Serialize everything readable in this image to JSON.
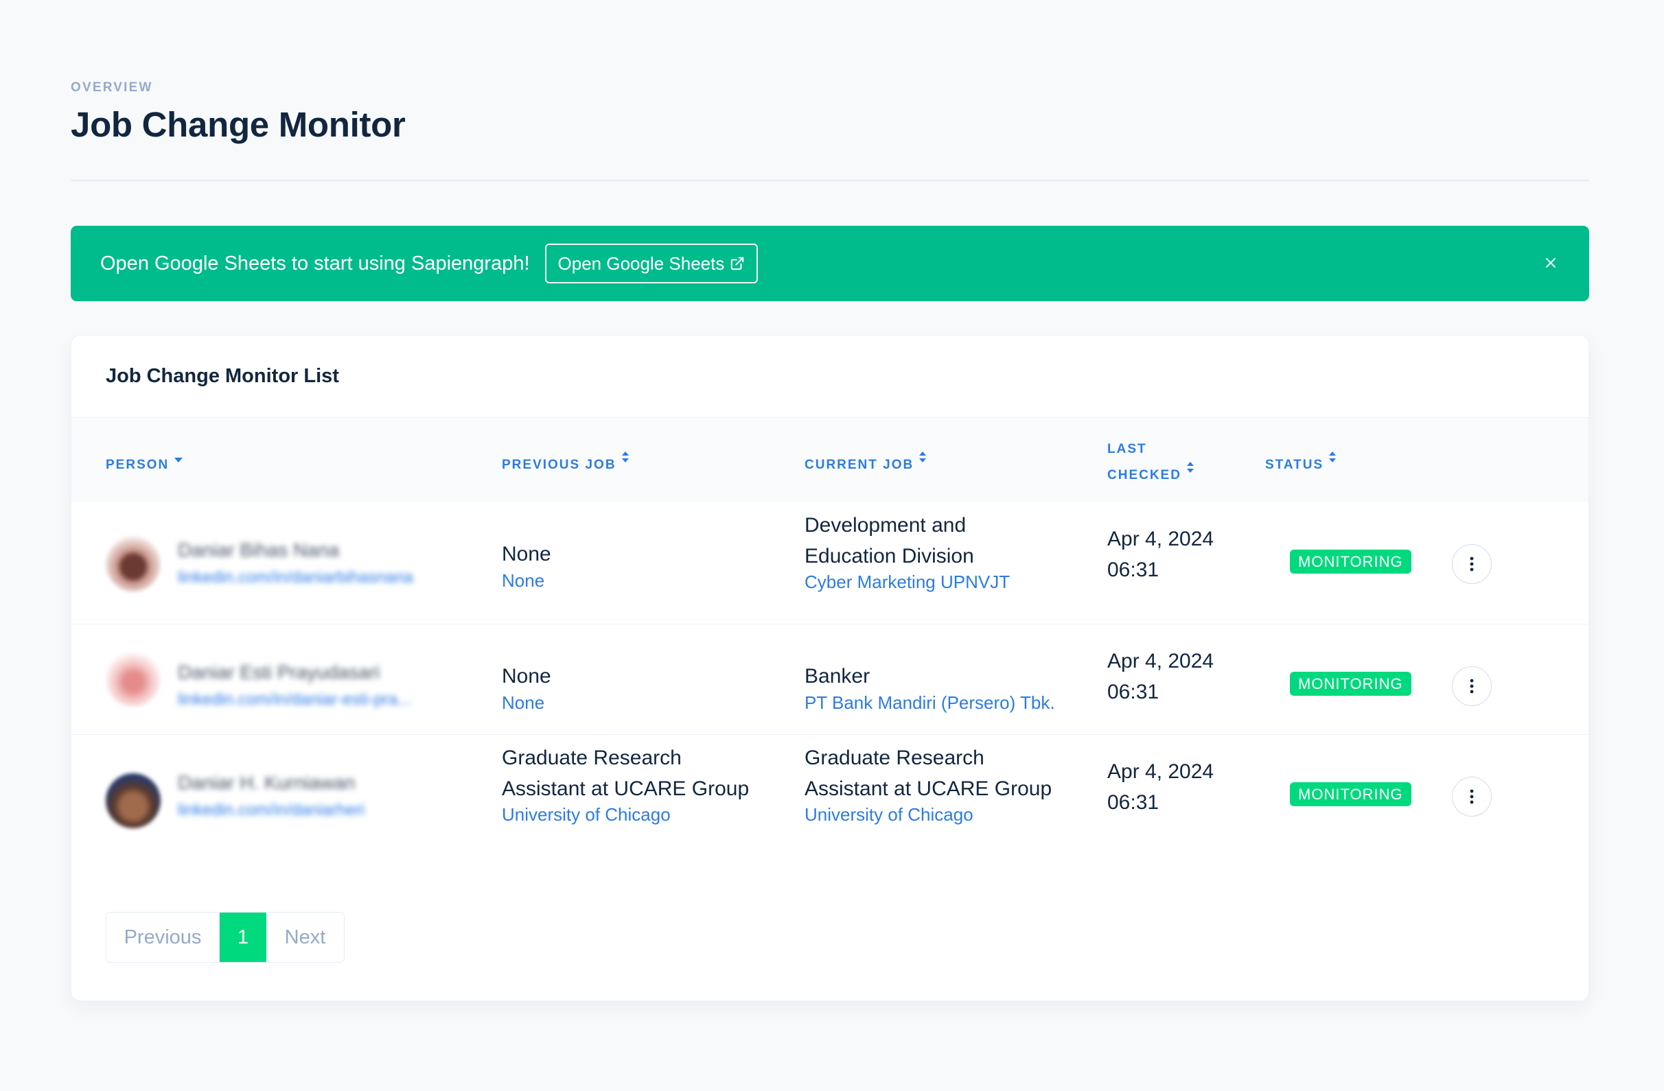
{
  "header": {
    "pretitle": "OVERVIEW",
    "title": "Job Change Monitor"
  },
  "banner": {
    "text": "Open Google Sheets to start using Sapiengraph!",
    "button_label": "Open Google Sheets",
    "button_icon": "external-link-icon",
    "close_icon": "close-icon",
    "color": "#00bb8c"
  },
  "card": {
    "title": "Job Change Monitor List"
  },
  "table": {
    "columns": [
      {
        "label": "PERSON",
        "sort_icon": "caret-down-icon"
      },
      {
        "label": "PREVIOUS JOB",
        "sort_icon": "sort-icon"
      },
      {
        "label": "CURRENT JOB",
        "sort_icon": "sort-icon"
      },
      {
        "label_line1": "LAST",
        "label_line2": "CHECKED",
        "sort_icon": "sort-icon"
      },
      {
        "label": "STATUS",
        "sort_icon": "sort-icon"
      }
    ],
    "rows": [
      {
        "person_name": "Daniar Bihas Nana",
        "person_link": "linkedin.com/in/daniarbihasnana",
        "prev_title": "None",
        "prev_org": "None",
        "cur_title_line1": "Development and",
        "cur_title_line2": "Education Division",
        "cur_org": "Cyber Marketing UPNVJT",
        "date_line1": "Apr 4, 2024",
        "date_line2": "06:31",
        "status": "MONITORING"
      },
      {
        "person_name": "Daniar Esti Prayudasari",
        "person_link": "linkedin.com/in/daniar-esti-pra...",
        "prev_title": "None",
        "prev_org": "None",
        "cur_title_line1": "Banker",
        "cur_org": "PT Bank Mandiri (Persero) Tbk.",
        "date_line1": "Apr 4, 2024",
        "date_line2": "06:31",
        "status": "MONITORING"
      },
      {
        "person_name": "Daniar H. Kurniawan",
        "person_link": "linkedin.com/in/daniarheri",
        "prev_title_line1": "Graduate Research",
        "prev_title_line2": "Assistant at UCARE Group",
        "prev_org": "University of Chicago",
        "cur_title_line1": "Graduate Research",
        "cur_title_line2": "Assistant at UCARE Group",
        "cur_org": "University of Chicago",
        "date_line1": "Apr 4, 2024",
        "date_line2": "06:31",
        "status": "MONITORING"
      }
    ]
  },
  "pagination": {
    "previous": "Previous",
    "current": "1",
    "next": "Next"
  },
  "colors": {
    "accent_green": "#00d97e",
    "link_blue": "#2c7be5",
    "text_dark": "#12263f",
    "muted": "#95aac9"
  }
}
